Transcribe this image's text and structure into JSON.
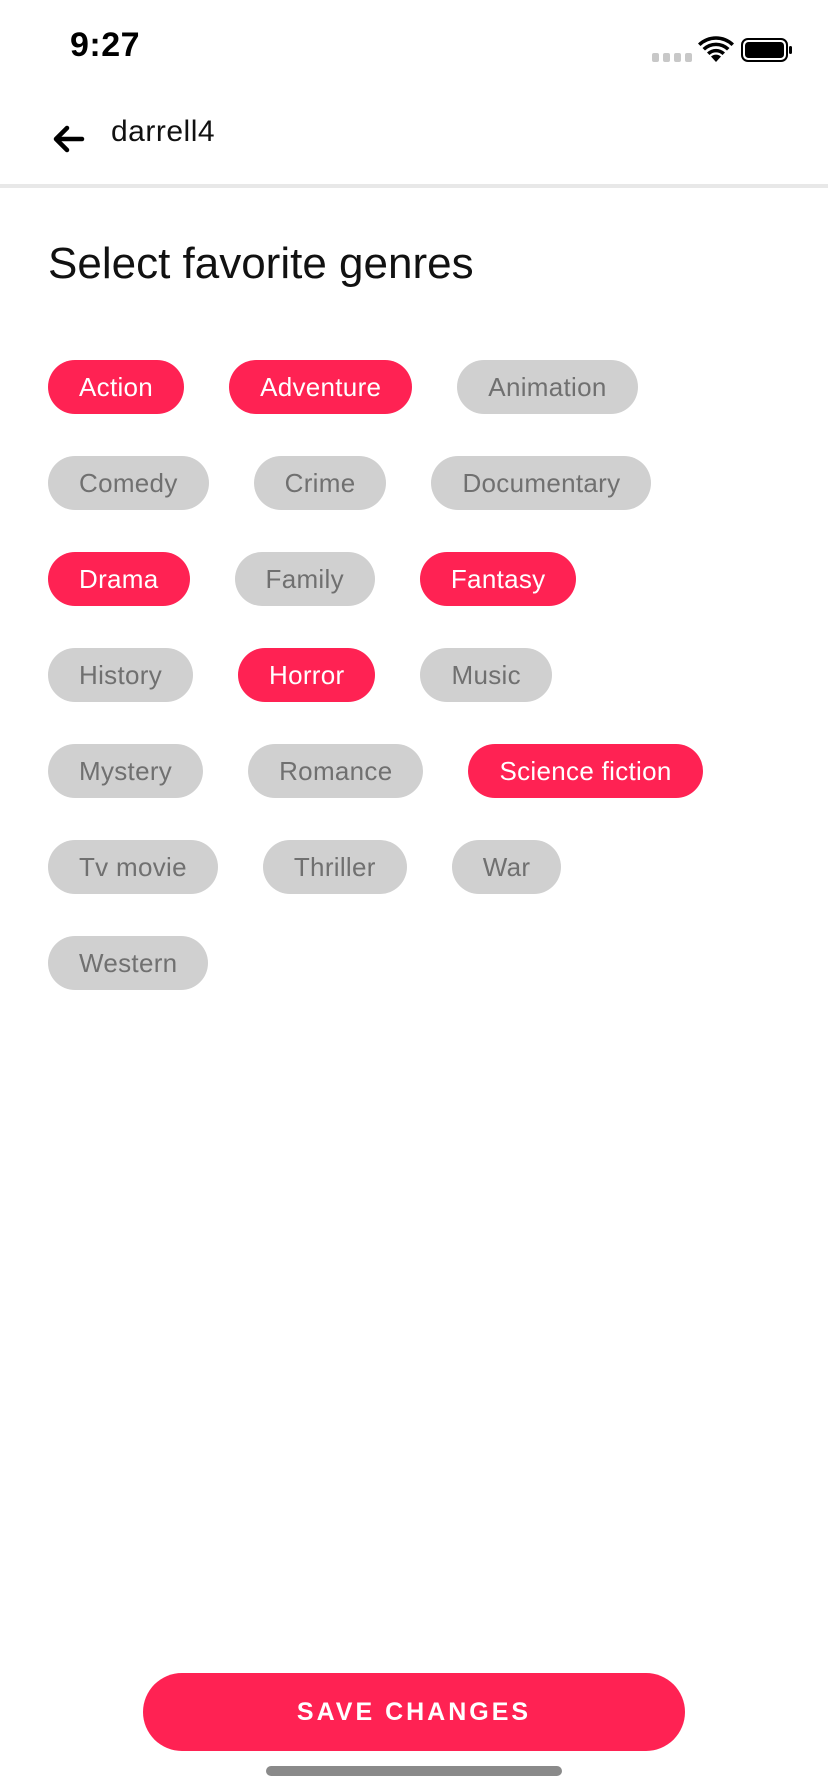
{
  "status_bar": {
    "time": "9:27"
  },
  "header": {
    "title": "darrell4",
    "back_icon": "arrow-left-icon"
  },
  "section_title": "Select favorite genres",
  "colors": {
    "accent": "#ff2253",
    "chip_off_bg": "#d0d0d0",
    "chip_off_text": "#707070"
  },
  "genres": [
    {
      "label": "Action",
      "selected": true
    },
    {
      "label": "Adventure",
      "selected": true
    },
    {
      "label": "Animation",
      "selected": false
    },
    {
      "label": "Comedy",
      "selected": false
    },
    {
      "label": "Crime",
      "selected": false
    },
    {
      "label": "Documentary",
      "selected": false
    },
    {
      "label": "Drama",
      "selected": true
    },
    {
      "label": "Family",
      "selected": false
    },
    {
      "label": "Fantasy",
      "selected": true
    },
    {
      "label": "History",
      "selected": false
    },
    {
      "label": "Horror",
      "selected": true
    },
    {
      "label": "Music",
      "selected": false
    },
    {
      "label": "Mystery",
      "selected": false
    },
    {
      "label": "Romance",
      "selected": false
    },
    {
      "label": "Science fiction",
      "selected": true
    },
    {
      "label": "Tv movie",
      "selected": false
    },
    {
      "label": "Thriller",
      "selected": false
    },
    {
      "label": "War",
      "selected": false
    },
    {
      "label": "Western",
      "selected": false
    }
  ],
  "save_button": {
    "label": "SAVE CHANGES"
  }
}
